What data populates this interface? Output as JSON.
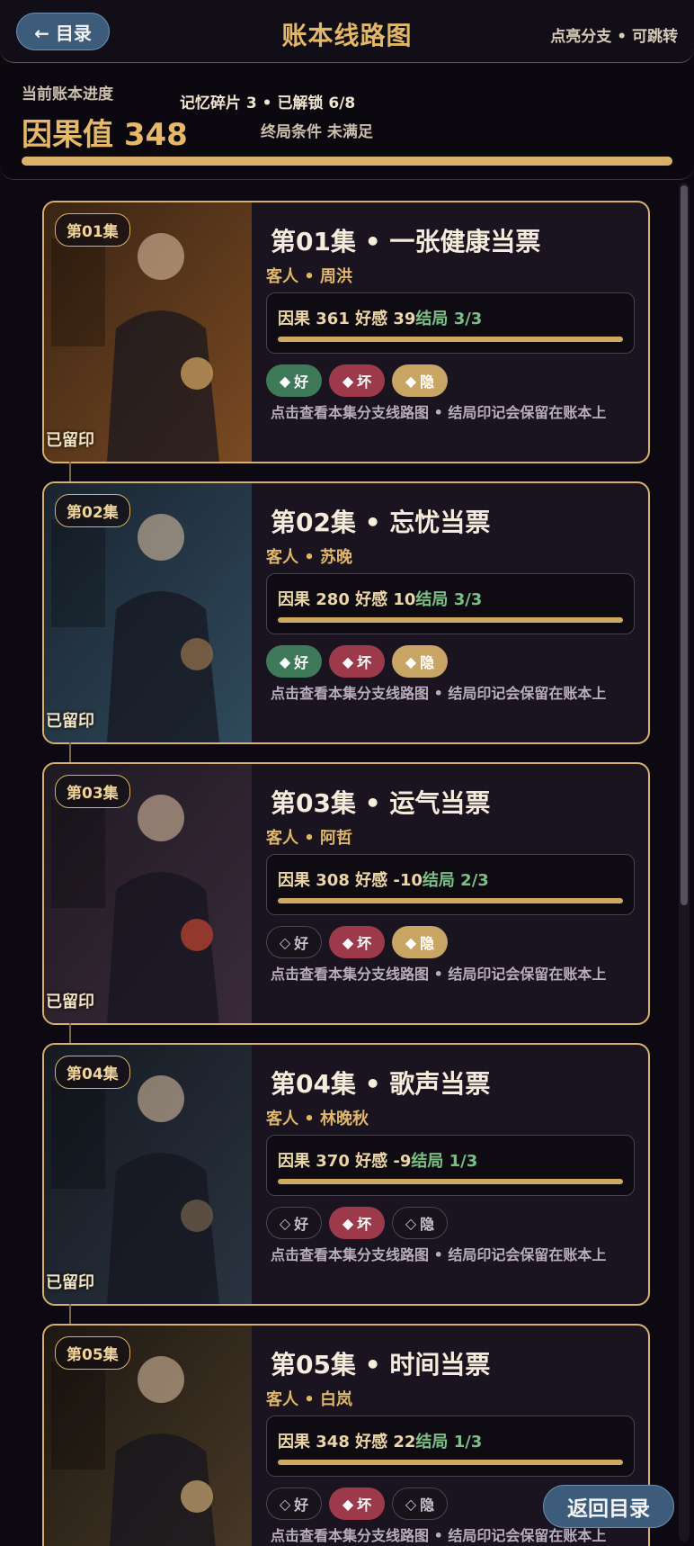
{
  "header": {
    "back_label": "← 目录",
    "title": "账本线路图",
    "hint": "点亮分支 • 可跳转"
  },
  "progress": {
    "label": "当前账本进度",
    "karma": "因果值 348",
    "memory": "记忆碎片 3 • 已解锁 6/8",
    "ending_condition": "终局条件 未满足",
    "fill_fraction": 1.0
  },
  "episodes": [
    {
      "badge": "第01集",
      "title": "第01集 • 一张健康当票",
      "guest": "客人 • 周洪",
      "stats": "因果 361 好感 39",
      "ending": "结局 3/3",
      "stamped": "已留印",
      "tags": [
        {
          "label": "好",
          "state": "good"
        },
        {
          "label": "坏",
          "state": "bad"
        },
        {
          "label": "隐",
          "state": "hidden"
        }
      ],
      "hint": "点击查看本集分支线路图 • 结局印记会保留在账本上"
    },
    {
      "badge": "第02集",
      "title": "第02集 • 忘忧当票",
      "guest": "客人 • 苏晚",
      "stats": "因果 280 好感 10",
      "ending": "结局 3/3",
      "stamped": "已留印",
      "tags": [
        {
          "label": "好",
          "state": "good"
        },
        {
          "label": "坏",
          "state": "bad"
        },
        {
          "label": "隐",
          "state": "hidden"
        }
      ],
      "hint": "点击查看本集分支线路图 • 结局印记会保留在账本上"
    },
    {
      "badge": "第03集",
      "title": "第03集 • 运气当票",
      "guest": "客人 • 阿哲",
      "stats": "因果 308 好感 -10",
      "ending": "结局 2/3",
      "stamped": "已留印",
      "tags": [
        {
          "label": "好",
          "state": "off"
        },
        {
          "label": "坏",
          "state": "bad"
        },
        {
          "label": "隐",
          "state": "hidden"
        }
      ],
      "hint": "点击查看本集分支线路图 • 结局印记会保留在账本上"
    },
    {
      "badge": "第04集",
      "title": "第04集 • 歌声当票",
      "guest": "客人 • 林晚秋",
      "stats": "因果 370 好感 -9",
      "ending": "结局 1/3",
      "stamped": "已留印",
      "tags": [
        {
          "label": "好",
          "state": "off"
        },
        {
          "label": "坏",
          "state": "bad"
        },
        {
          "label": "隐",
          "state": "off"
        }
      ],
      "hint": "点击查看本集分支线路图 • 结局印记会保留在账本上"
    },
    {
      "badge": "第05集",
      "title": "第05集 • 时间当票",
      "guest": "客人 • 白岚",
      "stats": "因果 348 好感 22",
      "ending": "结局 1/3",
      "stamped": "",
      "tags": [
        {
          "label": "好",
          "state": "off"
        },
        {
          "label": "坏",
          "state": "bad"
        },
        {
          "label": "隐",
          "state": "off"
        }
      ],
      "hint": "点击查看本集分支线路图 • 结局印记会保留在账本上"
    }
  ],
  "float_back_label": "返回目录",
  "colors": {
    "accent": "#d7b16a",
    "good": "#3e7a5a",
    "bad": "#9c3a4c",
    "hidden": "#c9a565",
    "button": "#3d5b7a"
  }
}
